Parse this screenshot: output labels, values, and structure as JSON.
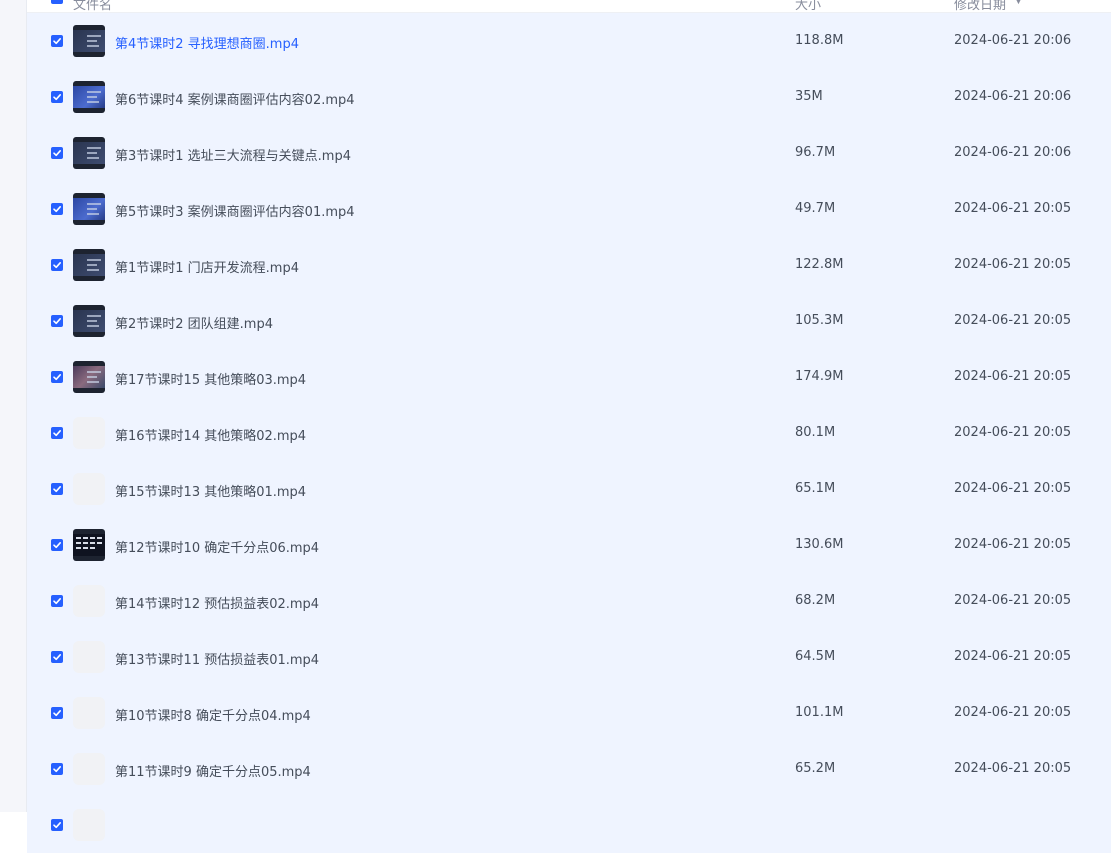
{
  "header": {
    "name_label": "文件名",
    "size_label": "大小",
    "date_label": "修改日期"
  },
  "files": [
    {
      "name": "第4节课时2 寻找理想商圈.mp4",
      "size": "118.8M",
      "date": "2024-06-21 20:06",
      "thumb": "video-dark",
      "hover": true
    },
    {
      "name": "第6节课时4 案例课商圈评估内容02.mp4",
      "size": "35M",
      "date": "2024-06-21 20:06",
      "thumb": "video-blue"
    },
    {
      "name": "第3节课时1 选址三大流程与关键点.mp4",
      "size": "96.7M",
      "date": "2024-06-21 20:06",
      "thumb": "video-dark"
    },
    {
      "name": "第5节课时3 案例课商圈评估内容01.mp4",
      "size": "49.7M",
      "date": "2024-06-21 20:05",
      "thumb": "video-blue"
    },
    {
      "name": "第1节课时1 门店开发流程.mp4",
      "size": "122.8M",
      "date": "2024-06-21 20:05",
      "thumb": "video-dark"
    },
    {
      "name": "第2节课时2 团队组建.mp4",
      "size": "105.3M",
      "date": "2024-06-21 20:05",
      "thumb": "video-dark"
    },
    {
      "name": "第17节课时15 其他策略03.mp4",
      "size": "174.9M",
      "date": "2024-06-21 20:05",
      "thumb": "video-people"
    },
    {
      "name": "第16节课时14 其他策略02.mp4",
      "size": "80.1M",
      "date": "2024-06-21 20:05",
      "thumb": "placeholder"
    },
    {
      "name": "第15节课时13 其他策略01.mp4",
      "size": "65.1M",
      "date": "2024-06-21 20:05",
      "thumb": "placeholder"
    },
    {
      "name": "第12节课时10 确定千分点06.mp4",
      "size": "130.6M",
      "date": "2024-06-21 20:05",
      "thumb": "video-slide"
    },
    {
      "name": "第14节课时12 预估损益表02.mp4",
      "size": "68.2M",
      "date": "2024-06-21 20:05",
      "thumb": "placeholder"
    },
    {
      "name": "第13节课时11 预估损益表01.mp4",
      "size": "64.5M",
      "date": "2024-06-21 20:05",
      "thumb": "placeholder"
    },
    {
      "name": "第10节课时8 确定千分点04.mp4",
      "size": "101.1M",
      "date": "2024-06-21 20:05",
      "thumb": "placeholder"
    },
    {
      "name": "第11节课时9 确定千分点05.mp4",
      "size": "65.2M",
      "date": "2024-06-21 20:05",
      "thumb": "placeholder"
    },
    {
      "name": "",
      "size": "",
      "date": "",
      "thumb": "placeholder"
    }
  ],
  "icons": {
    "checkbox": "checkbox-checked-icon",
    "sort": "sort-desc-icon"
  },
  "colors": {
    "accent": "#2660ff",
    "row_selected_bg": "#eff4ff",
    "text": "#454d5a"
  }
}
